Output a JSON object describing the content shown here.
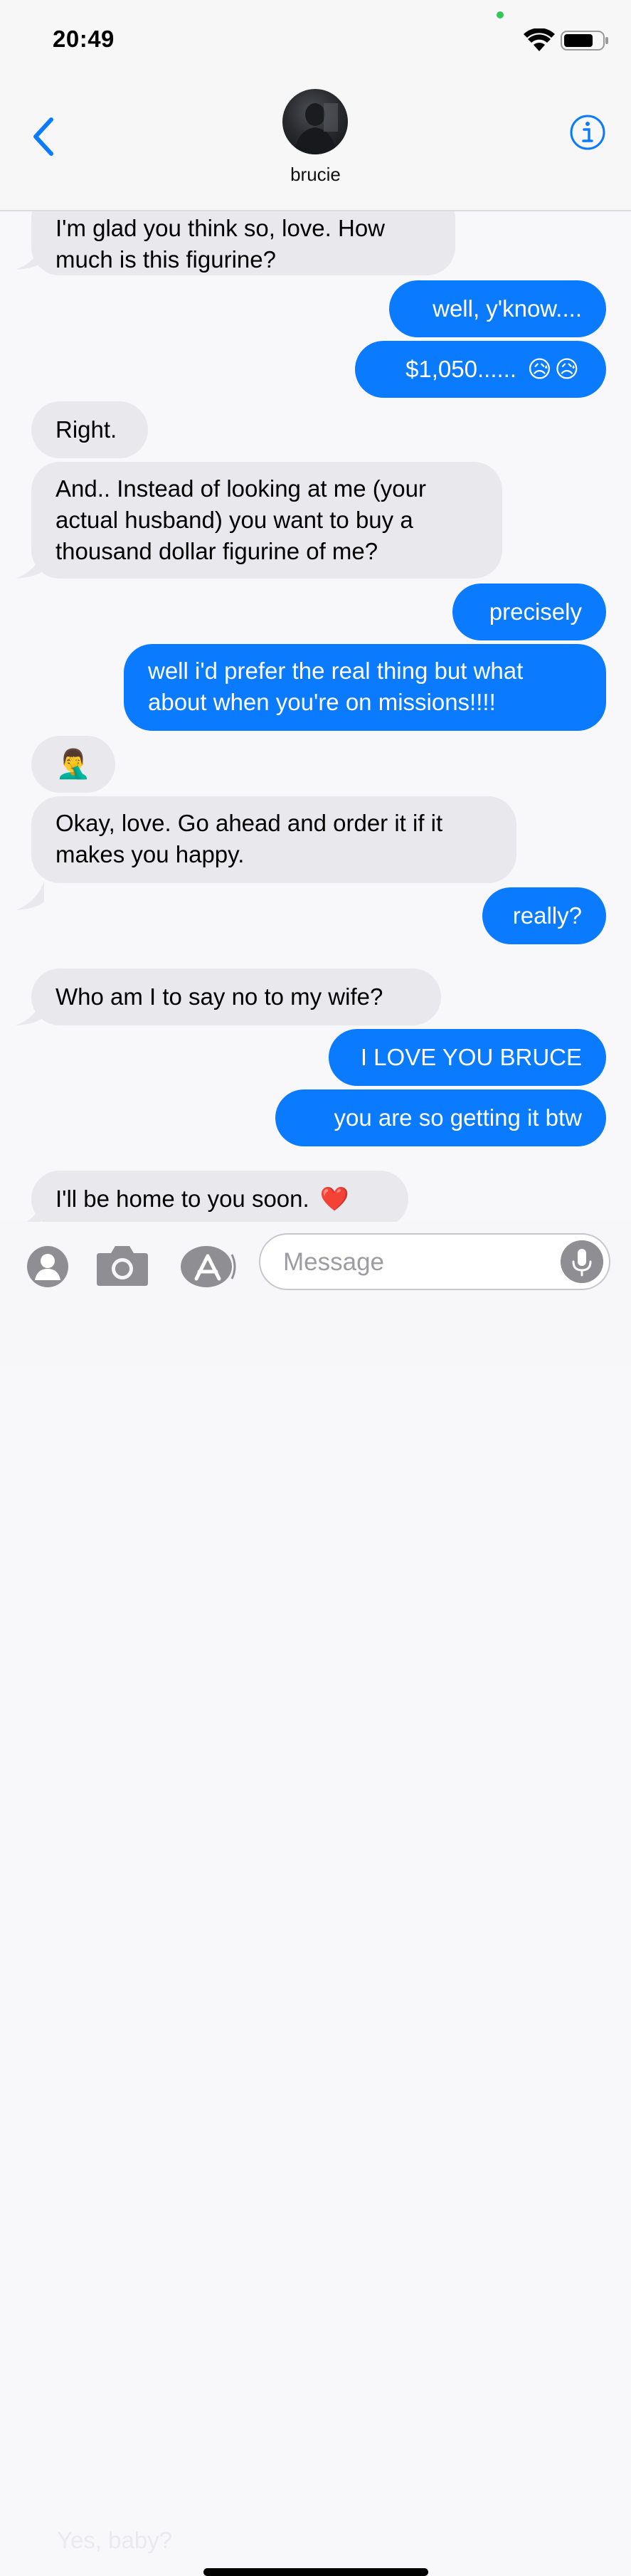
{
  "status_bar": {
    "time": "20:49"
  },
  "header": {
    "contact_name": "brucie"
  },
  "messages": [
    {
      "id": "m1",
      "from": "contact",
      "lines": [
        "I'm glad you think so, love. How",
        "much is this figurine?"
      ]
    },
    {
      "id": "m2",
      "from": "me",
      "lines": [
        "well, y'know...."
      ]
    },
    {
      "id": "m3",
      "from": "me",
      "lines": [
        "$1,050......"
      ],
      "emoji": "😥😥"
    },
    {
      "id": "m4",
      "from": "contact",
      "lines": [
        "Right."
      ]
    },
    {
      "id": "m5",
      "from": "contact",
      "lines": [
        "And.. Instead of looking at me (your",
        "actual husband) you want to buy a",
        "thousand dollar figurine of me?"
      ]
    },
    {
      "id": "m6",
      "from": "me",
      "lines": [
        "precisely"
      ]
    },
    {
      "id": "m7",
      "from": "me",
      "lines": [
        "well i'd prefer the real thing but what",
        "about when you're on missions!!!!"
      ]
    },
    {
      "id": "m8",
      "from": "contact",
      "emoji": "🤦‍♂️"
    },
    {
      "id": "m9",
      "from": "contact",
      "lines": [
        "Okay, love. Go ahead and order it if it",
        "makes you happy."
      ]
    },
    {
      "id": "m10",
      "from": "me",
      "lines": [
        "really?"
      ]
    },
    {
      "id": "m11",
      "from": "contact",
      "lines": [
        "Who am I to say no to my wife?"
      ]
    },
    {
      "id": "m12",
      "from": "me",
      "lines": [
        "I LOVE YOU BRUCE"
      ]
    },
    {
      "id": "m13",
      "from": "me",
      "lines": [
        "you are so getting it btw"
      ]
    },
    {
      "id": "m14",
      "from": "contact",
      "lines": [
        "I'll be home to you soon."
      ],
      "emoji": "❤️"
    }
  ],
  "compose": {
    "placeholder": "Message",
    "ghost_text": "Yes, baby?"
  },
  "icons": {
    "back": "chevron-left-icon",
    "info": "info-icon",
    "contacts": "person-icon",
    "camera": "camera-icon",
    "appstore": "app-store-icon",
    "mic": "microphone-icon"
  },
  "colors": {
    "accent": "#0a7aff",
    "incoming_bubble": "#e9e8ed",
    "background": "#f8f8fa"
  }
}
